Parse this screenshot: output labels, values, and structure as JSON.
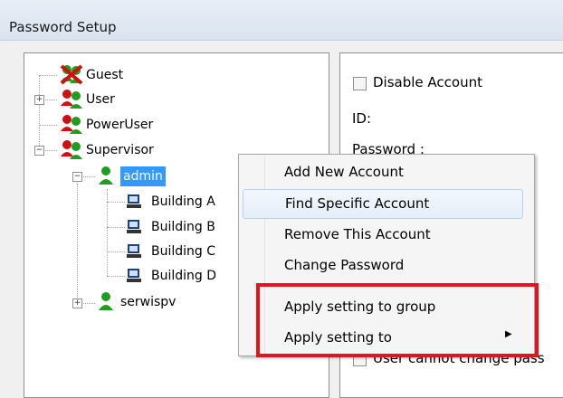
{
  "window": {
    "title": "Password Setup"
  },
  "tree": {
    "nodes": [
      {
        "label": "Guest",
        "icon": "group-x-icon"
      },
      {
        "label": "User",
        "icon": "group-icon"
      },
      {
        "label": "PowerUser",
        "icon": "group-icon"
      },
      {
        "label": "Supervisor",
        "icon": "group-icon"
      },
      {
        "label": "admin",
        "icon": "user-icon"
      },
      {
        "label": "Building A",
        "icon": "computer-icon"
      },
      {
        "label": "Building B",
        "icon": "computer-icon"
      },
      {
        "label": "Building C",
        "icon": "computer-icon"
      },
      {
        "label": "Building D",
        "icon": "computer-icon"
      },
      {
        "label": "serwispv",
        "icon": "user-icon"
      }
    ],
    "expand_symbols": {
      "collapsed": "+",
      "expanded": "−"
    }
  },
  "right": {
    "disable_account": "Disable Account",
    "id_label": "ID:",
    "password_label": "Password :",
    "bottom_checkbox": "User cannot change pass"
  },
  "context_menu": {
    "items": [
      {
        "label": "Add New Account"
      },
      {
        "label": "Find Specific Account"
      },
      {
        "label": "Remove This Account"
      },
      {
        "label": "Change Password"
      },
      {
        "label": "Apply setting to group"
      },
      {
        "label": "Apply setting to"
      }
    ],
    "submenu_arrow": "▶"
  },
  "colors": {
    "highlight": "#e4131c",
    "selection": "#3399ff"
  }
}
